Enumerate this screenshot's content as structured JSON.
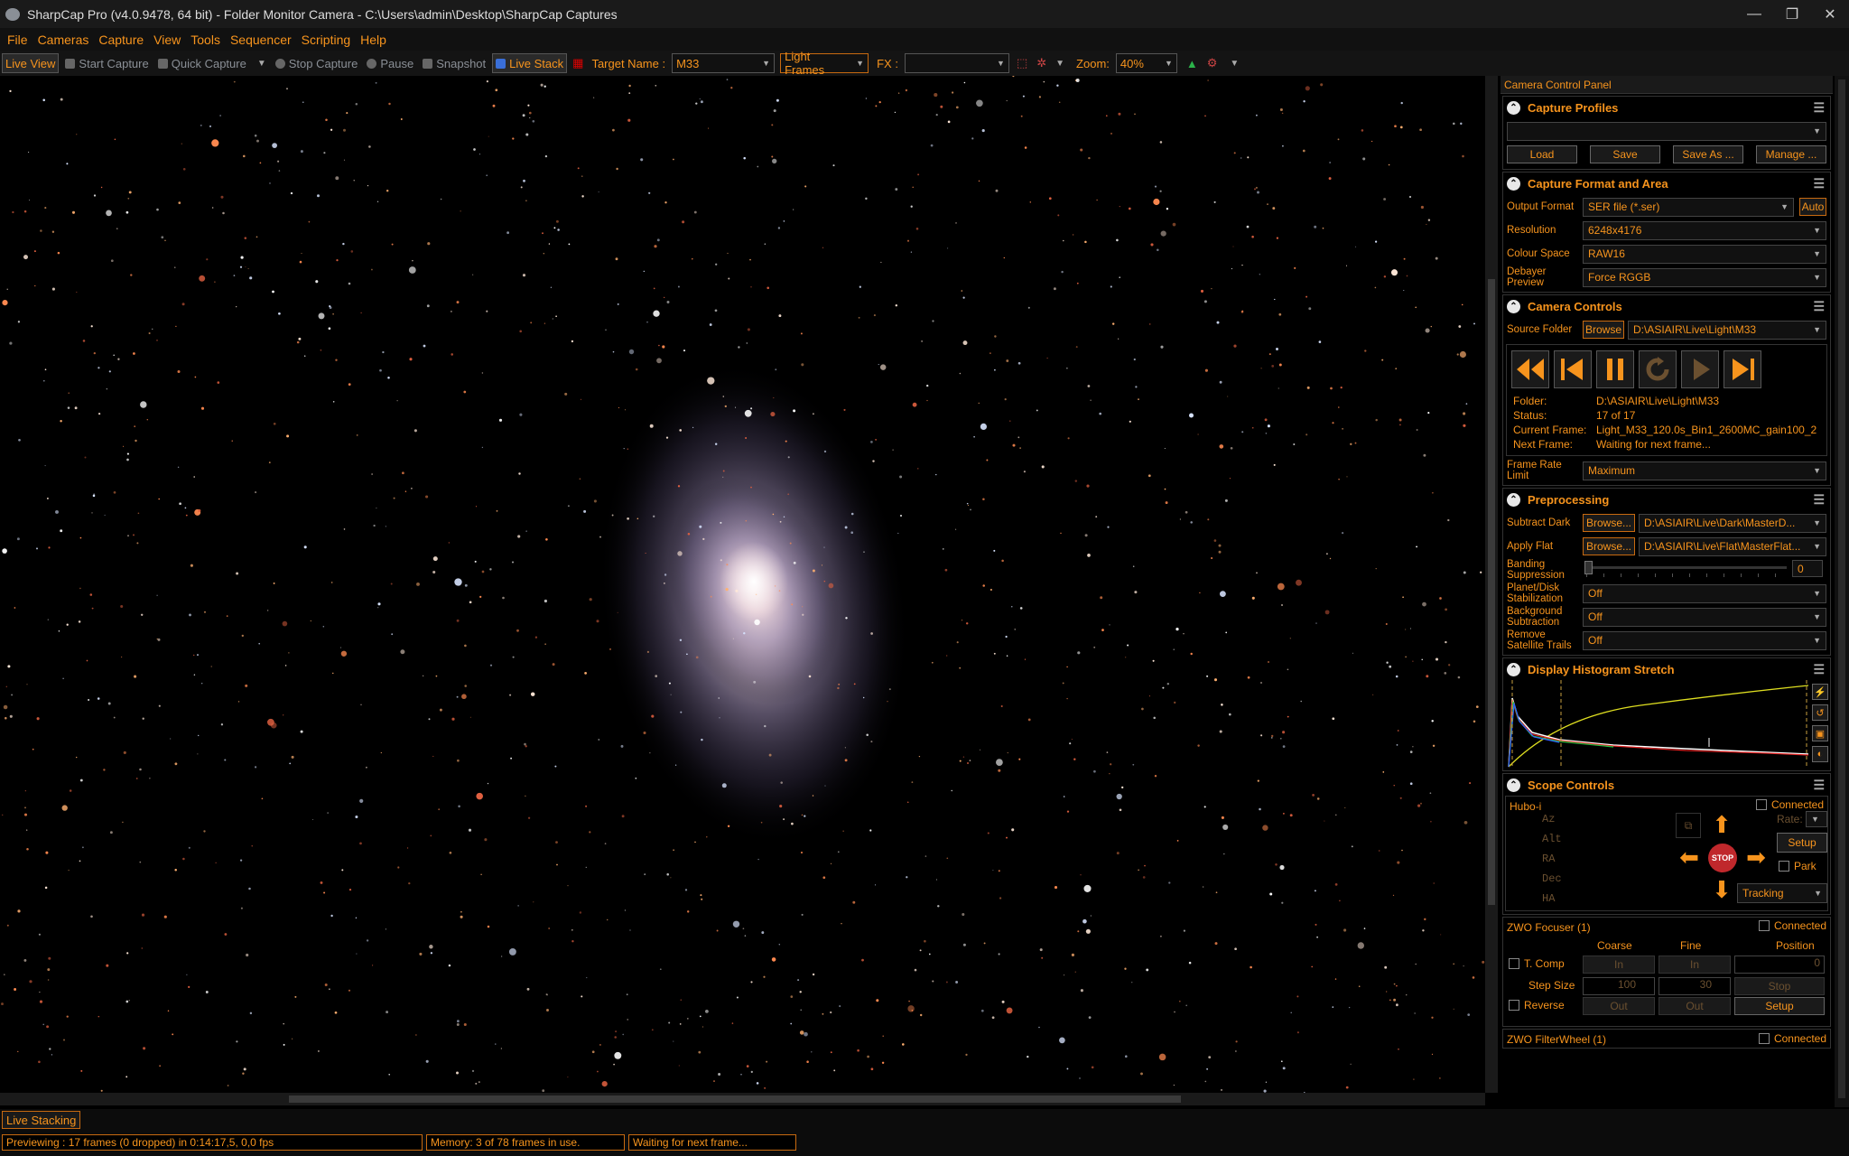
{
  "window": {
    "title": "SharpCap Pro (v4.0.9478, 64 bit) - Folder Monitor Camera - C:\\Users\\admin\\Desktop\\SharpCap Captures",
    "minimize": "—",
    "maximize": "❐",
    "close": "✕"
  },
  "menu": [
    "File",
    "Cameras",
    "Capture",
    "View",
    "Tools",
    "Sequencer",
    "Scripting",
    "Help"
  ],
  "toolbar": {
    "live_view": "Live View",
    "start_capture": "Start Capture",
    "quick_capture": "Quick Capture",
    "stop_capture": "Stop Capture",
    "pause": "Pause",
    "snapshot": "Snapshot",
    "live_stack": "Live Stack",
    "target_name_label": "Target Name :",
    "target_name_value": "M33",
    "frame_type": "Light Frames",
    "fx_label": "FX :",
    "fx_value": "",
    "zoom_label": "Zoom:",
    "zoom_value": "40%"
  },
  "panel": {
    "title": "Camera Control Panel",
    "capture_profiles": {
      "title": "Capture Profiles",
      "profile": "",
      "load": "Load",
      "save": "Save",
      "save_as": "Save As ...",
      "manage": "Manage ..."
    },
    "format": {
      "title": "Capture Format and Area",
      "output_format_label": "Output Format",
      "output_format": "SER file (*.ser)",
      "auto": "Auto",
      "resolution_label": "Resolution",
      "resolution": "6248x4176",
      "colour_space_label": "Colour Space",
      "colour_space": "RAW16",
      "debayer_label": "Debayer Preview",
      "debayer": "Force RGGB"
    },
    "camera": {
      "title": "Camera Controls",
      "source_folder_label": "Source Folder",
      "browse": "Browse",
      "source_folder": "D:\\ASIAIR\\Live\\Light\\M33",
      "folder_label": "Folder:",
      "folder": "D:\\ASIAIR\\Live\\Light\\M33",
      "status_label": "Status:",
      "status": "17 of 17",
      "current_frame_label": "Current Frame:",
      "current_frame": "Light_M33_120.0s_Bin1_2600MC_gain100_2",
      "next_frame_label": "Next Frame:",
      "next_frame": "Waiting for next frame...",
      "frame_rate_label": "Frame Rate Limit",
      "frame_rate": "Maximum"
    },
    "preprocessing": {
      "title": "Preprocessing",
      "subtract_dark_label": "Subtract Dark",
      "browse": "Browse...",
      "subtract_dark": "D:\\ASIAIR\\Live\\Dark\\MasterD...",
      "apply_flat_label": "Apply Flat",
      "apply_flat": "D:\\ASIAIR\\Live\\Flat\\MasterFlat...",
      "banding_label": "Banding Suppression",
      "banding_value": "0",
      "planet_label": "Planet/Disk Stabilization",
      "planet": "Off",
      "background_label": "Background Subtraction",
      "background": "Off",
      "satellite_label": "Remove Satellite Trails",
      "satellite": "Off"
    },
    "histogram": {
      "title": "Display Histogram Stretch"
    },
    "scope": {
      "title": "Scope Controls",
      "device": "Hubo-i",
      "connected": "Connected",
      "az": "Az",
      "alt": "Alt",
      "ra": "RA",
      "dec": "Dec",
      "ha": "HA",
      "rate": "Rate:",
      "setup": "Setup",
      "park": "Park",
      "stop": "STOP",
      "tracking": "Tracking"
    },
    "focuser": {
      "title": "ZWO Focuser (1)",
      "connected": "Connected",
      "coarse": "Coarse",
      "fine": "Fine",
      "position": "Position",
      "tcomp": "T. Comp",
      "in": "In",
      "position_value": "0",
      "step_size": "Step Size",
      "coarse_step": "100",
      "fine_step": "30",
      "stop": "Stop",
      "reverse": "Reverse",
      "out": "Out",
      "setup": "Setup"
    },
    "filterwheel": {
      "title": "ZWO FilterWheel (1)",
      "connected": "Connected"
    }
  },
  "status": {
    "live_stacking": "Live Stacking",
    "previewing": "Previewing : 17 frames (0 dropped) in 0:14:17,5, 0,0 fps",
    "memory": "Memory: 3 of 78 frames in use.",
    "waiting": "Waiting for next frame..."
  },
  "colors": {
    "accent": "#f7941d",
    "background": "#000000",
    "chrome": "#1a1a1a"
  }
}
